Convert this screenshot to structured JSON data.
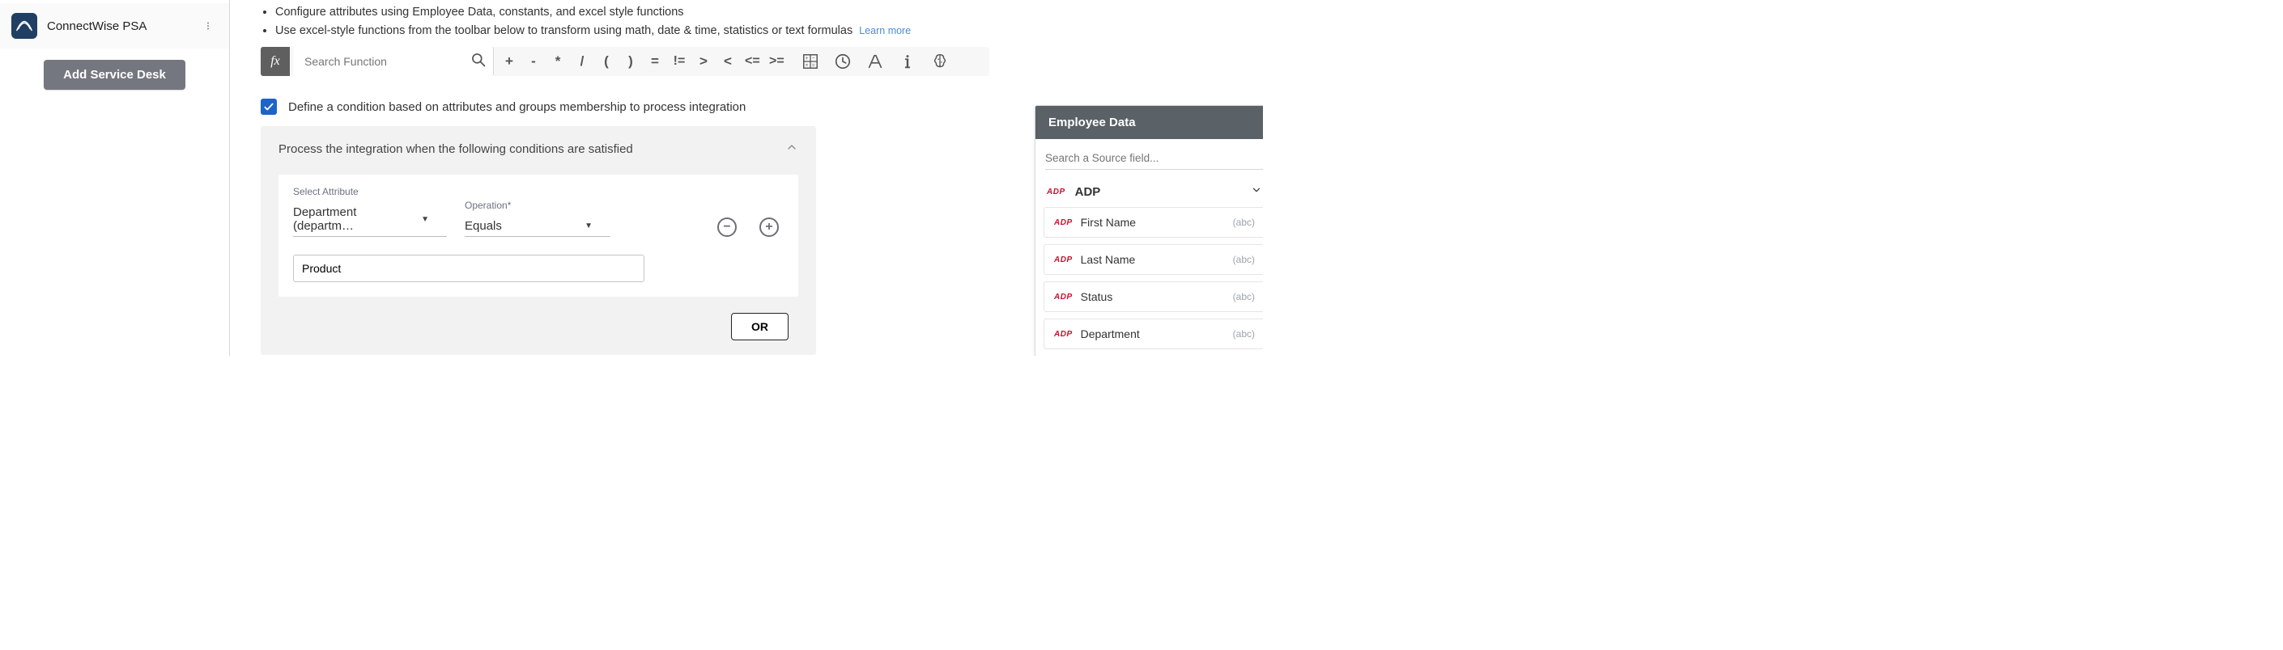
{
  "sidebar": {
    "app_name": "ConnectWise PSA",
    "add_button": "Add Service Desk"
  },
  "instructions": {
    "line1": "Configure attributes using Employee Data, constants, and excel style functions",
    "line2": "Use excel-style functions from the toolbar below to transform using math, date & time, statistics or text formulas",
    "learn_more": "Learn more"
  },
  "toolbar": {
    "fx_label": "fx",
    "search_placeholder": "Search Function",
    "operators": [
      "+",
      "-",
      "*",
      "/",
      "(",
      ")",
      "=",
      "!=",
      ">",
      "<",
      "<=",
      ">="
    ]
  },
  "condition": {
    "checkbox_checked": true,
    "label": "Define a condition based on attributes and groups membership to process integration",
    "card_title": "Process the integration when the following conditions are satisfied",
    "attribute_label": "Select Attribute",
    "attribute_value": "Department (departm…",
    "operation_label": "Operation*",
    "operation_value": "Equals",
    "value_input": "Product",
    "or_label": "OR"
  },
  "right_panel": {
    "title": "Employee Data",
    "search_placeholder": "Search a Source field...",
    "provider": "ADP",
    "fields": [
      {
        "name": "First Name",
        "type": "(abc)"
      },
      {
        "name": "Last Name",
        "type": "(abc)"
      },
      {
        "name": "Status",
        "type": "(abc)"
      },
      {
        "name": "Department",
        "type": "(abc)"
      }
    ]
  }
}
